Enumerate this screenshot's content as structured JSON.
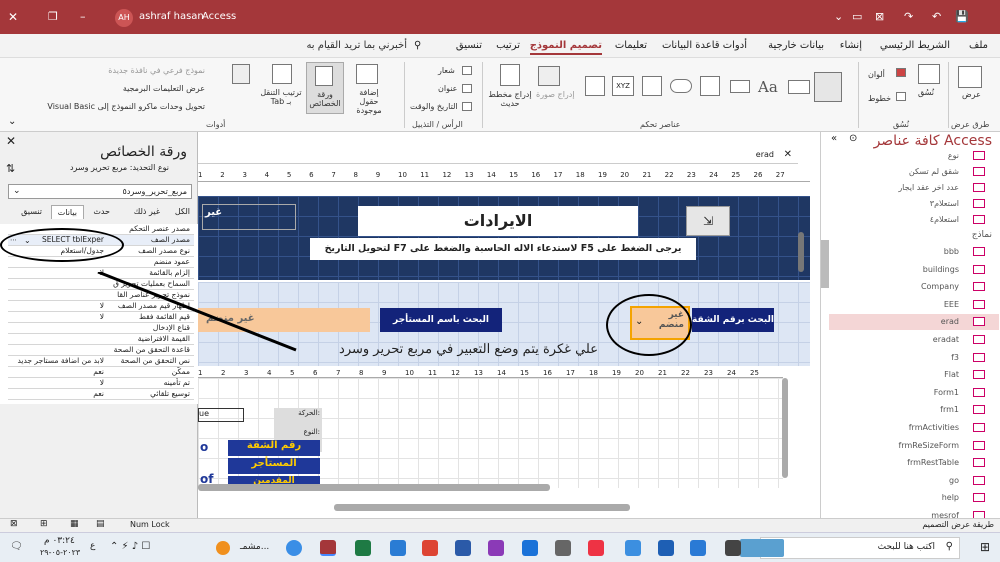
{
  "titlebar": {
    "user_initials": "AH",
    "user_name": "ashraf hasan",
    "app_name": "Access"
  },
  "menu": {
    "items": [
      "ملف",
      "الشريط الرئيسي",
      "إنشاء",
      "بيانات خارجية",
      "أدوات قاعدة البيانات",
      "تعليمات",
      "تصميم النموذج",
      "ترتيب",
      "تنسيق"
    ],
    "search": "أخبرني بما تريد القيام به"
  },
  "ribbon": {
    "views": {
      "label": "عرض",
      "group": "طرق عرض"
    },
    "themes": {
      "theme": "نُسُق",
      "colors": "ألوان",
      "fonts": "خطوط",
      "group": "نُسُق"
    },
    "controls": {
      "group": "عناصر تحكم",
      "insert_image": "إدراج صورة",
      "insert_chart": "إدراج مخطط حديث"
    },
    "header": {
      "logo": "شعار",
      "title": "عنوان",
      "datetime": "التاريخ والوقت",
      "group": "الرأس / التذييل"
    },
    "tools": {
      "add_fields": "إضافة حقول موجودة",
      "property_sheet": "ورقة الخصائص",
      "tab_order": "ترتيب التنقل بـ Tab",
      "subform": "نموذج فرعي في نافذة جديدة",
      "view_code": "عرض التعليمات البرمجية",
      "convert_macros": "تحويل وحدات ماكرو النموذج إلى Visual Basic",
      "group": "أدوات"
    }
  },
  "property_sheet": {
    "title": "ورقة الخصائص",
    "selection_type": "نوع التحديد: مربع تحرير وسرد",
    "selected_object": "مربع_تحرير_وسرد٥",
    "tabs": [
      "الكل",
      "غير ذلك",
      "حدث",
      "بيانات",
      "تنسيق"
    ],
    "active_tab": "بيانات",
    "rows": [
      {
        "k": "مصدر عنصر التحكم",
        "v": ""
      },
      {
        "k": "مصدر الصف",
        "v": "SELECT tblExper"
      },
      {
        "k": "نوع مصدر الصف",
        "v": "جدول/استعلام"
      },
      {
        "k": "عمود منضم",
        "v": ""
      },
      {
        "k": "إلزام بالقائمة",
        "v": "لا"
      },
      {
        "k": "السماح بعمليات تحرير ق",
        "v": ""
      },
      {
        "k": "نموذج تحرير عناصر القا",
        "v": ""
      },
      {
        "k": "إظهار قيم مصدر الصف",
        "v": "لا"
      },
      {
        "k": "قيم القائمة فقط",
        "v": "لا"
      },
      {
        "k": "قناع الإدخال",
        "v": ""
      },
      {
        "k": "القيمة الافتراضية",
        "v": ""
      },
      {
        "k": "قاعدة التحقق من الصحة",
        "v": ""
      },
      {
        "k": "نص التحقق من الصحة",
        "v": "لابد من اضافة مستاجر جديد"
      },
      {
        "k": "ممكّن",
        "v": "نعم"
      },
      {
        "k": "تم تأمينه",
        "v": "لا"
      },
      {
        "k": "توسيع تلقائي",
        "v": "نعم"
      }
    ]
  },
  "form": {
    "tab_name": "erad",
    "ruler_numbers": [
      "27",
      "26",
      "25",
      "24",
      "23",
      "22",
      "21",
      "20",
      "19",
      "18",
      "17",
      "16",
      "15",
      "14",
      "13",
      "12",
      "11",
      "10",
      "9",
      "8",
      "7",
      "6",
      "5",
      "4",
      "3",
      "2",
      "1"
    ],
    "title": "الايرادات",
    "instruction": "يرجى الضغط على F5 لاستدعاء الاله الحاسبة والضغط على F7 لتحويل التاريخ",
    "unbound_top": "غير",
    "search_unit_label": "البحث برقم الشقة",
    "search_tenant_label": "البحث باسم المستأجر",
    "unbound_combo": "غير منضم",
    "unbound_right": "غير منضم",
    "annotation": "علي غكرة يتم وضع التعبير في مربع تحرير وسرد",
    "sub_labels": [
      "رقم الشقة",
      "المستأجر",
      "المقدمين"
    ],
    "sub_movement": "الحركة:",
    "sub_type": "النوع:",
    "sub_left_a": "o",
    "sub_left_b": "of",
    "sub_left_input": "ue"
  },
  "nav_pane": {
    "title": "كافة عناصر Access",
    "section": "نماذج",
    "items_top": [
      "نوع",
      "شقق لم تسكن",
      "عدد اخر عقد ايجار",
      "استعلام٣",
      "استعلام٤"
    ],
    "items": [
      "bbb",
      "buildings",
      "Company",
      "EEE",
      "erad",
      "eradat",
      "f3",
      "Flat",
      "Form1",
      "frm1",
      "frmActivities",
      "frmReSizeForm",
      "frmRestTable",
      "go",
      "help",
      "mesrof"
    ],
    "selected": "erad"
  },
  "status": {
    "left": "طريقة عرض التصميم",
    "num_lock": "Num Lock"
  },
  "taskbar": {
    "search": "اكتب هنا للبحث",
    "time": "٠٣:٢٤ م",
    "date": "٢٠٢٣-٠٥-٢٩",
    "lang": "ع",
    "weather": "مشمـ..."
  }
}
